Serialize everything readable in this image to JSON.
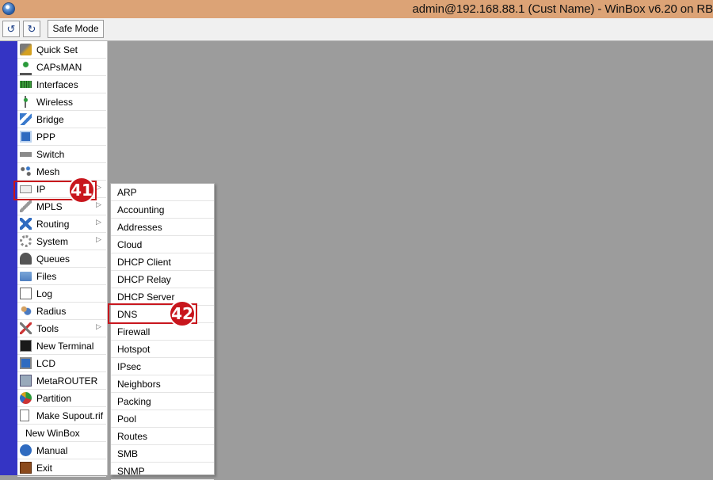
{
  "window": {
    "title": "admin@192.168.88.1 (Cust Name) - WinBox v6.20 on RB",
    "icon": "winbox-icon"
  },
  "toolbar": {
    "undo_icon": "undo-icon",
    "redo_icon": "redo-icon",
    "safe_mode_label": "Safe Mode"
  },
  "colors": {
    "titlebar": "#dca376",
    "sidebar_strip": "#3434c4",
    "workspace": "#9c9c9c",
    "callout": "#c8161d"
  },
  "menu": {
    "items": [
      {
        "label": "Quick Set",
        "icon": "quick-set-icon",
        "has_submenu": false
      },
      {
        "label": "CAPsMAN",
        "icon": "capsman-icon",
        "has_submenu": false
      },
      {
        "label": "Interfaces",
        "icon": "interfaces-icon",
        "has_submenu": false
      },
      {
        "label": "Wireless",
        "icon": "wireless-icon",
        "has_submenu": false
      },
      {
        "label": "Bridge",
        "icon": "bridge-icon",
        "has_submenu": false
      },
      {
        "label": "PPP",
        "icon": "ppp-icon",
        "has_submenu": false
      },
      {
        "label": "Switch",
        "icon": "switch-icon",
        "has_submenu": false
      },
      {
        "label": "Mesh",
        "icon": "mesh-icon",
        "has_submenu": false
      },
      {
        "label": "IP",
        "icon": "ip-icon",
        "has_submenu": true
      },
      {
        "label": "MPLS",
        "icon": "mpls-icon",
        "has_submenu": true
      },
      {
        "label": "Routing",
        "icon": "routing-icon",
        "has_submenu": true
      },
      {
        "label": "System",
        "icon": "system-gear-icon",
        "has_submenu": true
      },
      {
        "label": "Queues",
        "icon": "queues-icon",
        "has_submenu": false
      },
      {
        "label": "Files",
        "icon": "folder-icon",
        "has_submenu": false
      },
      {
        "label": "Log",
        "icon": "log-icon",
        "has_submenu": false
      },
      {
        "label": "Radius",
        "icon": "radius-users-icon",
        "has_submenu": false
      },
      {
        "label": "Tools",
        "icon": "tools-icon",
        "has_submenu": true
      },
      {
        "label": "New Terminal",
        "icon": "terminal-icon",
        "has_submenu": false
      },
      {
        "label": "LCD",
        "icon": "lcd-icon",
        "has_submenu": false
      },
      {
        "label": "MetaROUTER",
        "icon": "metarouter-icon",
        "has_submenu": false
      },
      {
        "label": "Partition",
        "icon": "partition-pie-icon",
        "has_submenu": false
      },
      {
        "label": "Make Supout.rif",
        "icon": "document-icon",
        "has_submenu": false
      },
      {
        "label": "New WinBox",
        "icon": "",
        "has_submenu": false
      },
      {
        "label": "Manual",
        "icon": "help-icon",
        "has_submenu": false
      },
      {
        "label": "Exit",
        "icon": "exit-door-icon",
        "has_submenu": false
      }
    ]
  },
  "submenu": {
    "items": [
      "ARP",
      "Accounting",
      "Addresses",
      "Cloud",
      "DHCP Client",
      "DHCP Relay",
      "DHCP Server",
      "DNS",
      "Firewall",
      "Hotspot",
      "IPsec",
      "Neighbors",
      "Packing",
      "Pool",
      "Routes",
      "SMB",
      "SNMP"
    ]
  },
  "callouts": {
    "ip": "41",
    "dns": "42"
  }
}
